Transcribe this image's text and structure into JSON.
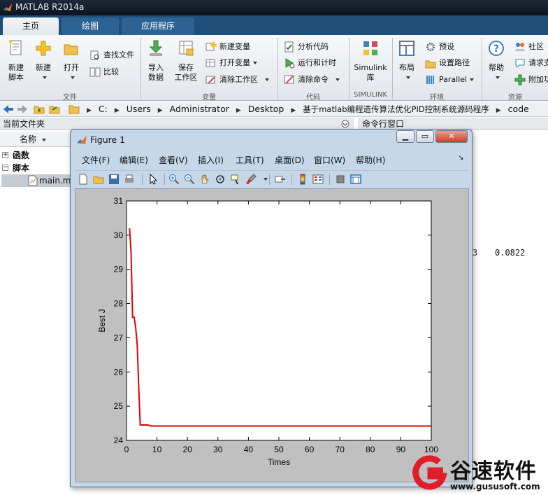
{
  "app": {
    "title": "MATLAB R2014a"
  },
  "tabs": [
    "主页",
    "绘图",
    "应用程序"
  ],
  "ribbon": {
    "file": {
      "label": "文件",
      "new_script": "新建\n脚本",
      "new": "新建",
      "open": "打开",
      "find_files": "查找文件",
      "compare": "比较"
    },
    "variable": {
      "label": "变量",
      "import_data": "导入\n数据",
      "save_workspace": "保存\n工作区",
      "new_variable": "新建变量",
      "open_variable": "打开变量",
      "clear_workspace": "清除工作区"
    },
    "code": {
      "label": "代码",
      "analyze_code": "分析代码",
      "run_and_time": "运行和计时",
      "clear_commands": "清除命令"
    },
    "simulink": {
      "label": "SIMULINK",
      "library": "Simulink\n库"
    },
    "environment": {
      "label": "环境",
      "layout": "布局",
      "preferences": "预设",
      "set_path": "设置路径",
      "parallel": "Parallel"
    },
    "resources": {
      "label": "资源",
      "help": "帮助",
      "community": "社区",
      "request_support": "请求支",
      "add_ons": "附加功"
    }
  },
  "address": {
    "crumbs": [
      "C:",
      "Users",
      "Administrator",
      "Desktop",
      "基于matlab编程遗传算法优化PID控制系统源码程序",
      "code"
    ]
  },
  "current_folder": {
    "header": "当前文件夹",
    "column": "名称",
    "functions": "函数",
    "scripts": "脚本",
    "file": "main.m"
  },
  "command_window": {
    "header": "命令行窗口",
    "value": "0.0822"
  },
  "figure": {
    "title": "Figure 1",
    "menu": [
      "文件(F)",
      "编辑(E)",
      "查看(V)",
      "插入(I)",
      "工具(T)",
      "桌面(D)",
      "窗口(W)",
      "帮助(H)"
    ]
  },
  "chart_data": {
    "type": "line",
    "title": "",
    "xlabel": "Times",
    "ylabel": "Best J",
    "xlim": [
      0,
      100
    ],
    "ylim": [
      24,
      31
    ],
    "xticks": [
      0,
      10,
      20,
      30,
      40,
      50,
      60,
      70,
      80,
      90,
      100
    ],
    "yticks": [
      24,
      25,
      26,
      27,
      28,
      29,
      30,
      31
    ],
    "grid": false,
    "color": "#e00000",
    "series": [
      {
        "x": [
          1,
          1.5,
          2,
          2.5,
          3,
          3.5,
          4,
          4.5,
          5,
          6,
          7,
          8,
          9,
          10,
          20,
          30,
          40,
          50,
          60,
          70,
          80,
          90,
          100
        ],
        "y": [
          30.2,
          29.5,
          27.6,
          27.6,
          27.3,
          26.8,
          25.6,
          24.45,
          24.45,
          24.45,
          24.45,
          24.42,
          24.42,
          24.42,
          24.42,
          24.42,
          24.42,
          24.42,
          24.42,
          24.42,
          24.42,
          24.42,
          24.42
        ]
      }
    ]
  },
  "watermark": {
    "text": "谷速软件",
    "url": "www.gususoft.com"
  }
}
